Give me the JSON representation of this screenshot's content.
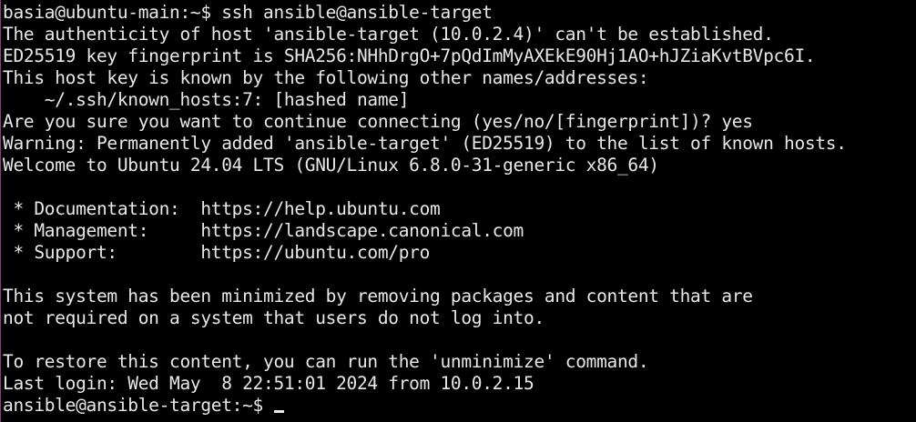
{
  "terminal": {
    "lines": [
      "basia@ubuntu-main:~$ ssh ansible@ansible-target",
      "The authenticity of host 'ansible-target (10.0.2.4)' can't be established.",
      "ED25519 key fingerprint is SHA256:NHhDrgO+7pQdImMyAXEkE90Hj1AO+hJZiaKvtBVpc6I.",
      "This host key is known by the following other names/addresses:",
      "    ~/.ssh/known_hosts:7: [hashed name]",
      "Are you sure you want to continue connecting (yes/no/[fingerprint])? yes",
      "Warning: Permanently added 'ansible-target' (ED25519) to the list of known hosts.",
      "Welcome to Ubuntu 24.04 LTS (GNU/Linux 6.8.0-31-generic x86_64)",
      "",
      " * Documentation:  https://help.ubuntu.com",
      " * Management:     https://landscape.canonical.com",
      " * Support:        https://ubuntu.com/pro",
      "",
      "This system has been minimized by removing packages and content that are",
      "not required on a system that users do not log into.",
      "",
      "To restore this content, you can run the 'unminimize' command.",
      "Last login: Wed May  8 22:51:01 2024 from 10.0.2.15"
    ],
    "prompt": "ansible@ansible-target:~$ "
  },
  "colors": {
    "background": "#000000",
    "foreground": "#e8e8e8",
    "window_edge": "#8e3a86"
  }
}
